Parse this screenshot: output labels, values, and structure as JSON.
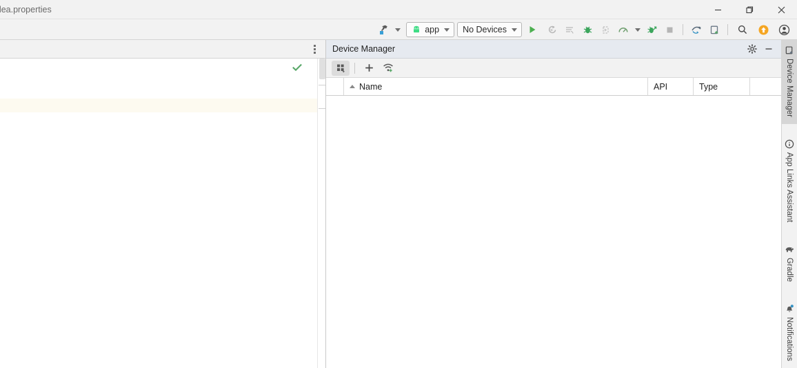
{
  "window": {
    "title": "idea.properties",
    "controls": {
      "minimize": "Minimize",
      "restore": "Restore",
      "close": "Close"
    }
  },
  "toolbar": {
    "build_icon": "hammer-build-icon",
    "build_dropdown": "chevron-down-icon",
    "run_config": {
      "icon": "android-robot-icon",
      "label": "app",
      "dropdown": "chevron-down-icon"
    },
    "device_selector": {
      "label": "No Devices",
      "dropdown": "chevron-down-icon"
    },
    "actions": [
      {
        "name": "run-button",
        "icon": "play-triangle-icon",
        "label": "Run",
        "color": "#4caf50"
      },
      {
        "name": "apply-changes-button",
        "icon": "apply-changes-icon",
        "label": "Apply Changes",
        "color": "#b0b0b0"
      },
      {
        "name": "run-with-coverage-button",
        "icon": "coverage-lines-icon",
        "label": "Run with Coverage",
        "color": "#b0b0b0"
      },
      {
        "name": "debug-button",
        "icon": "bug-icon",
        "label": "Debug",
        "color": "#3ba55c"
      },
      {
        "name": "attach-debugger-button",
        "icon": "attach-debugger-icon",
        "label": "Attach Debugger to Process",
        "color": "#b0b0b0"
      },
      {
        "name": "profiler-button",
        "icon": "profiler-gauge-icon",
        "label": "Profile",
        "color": "#6e9e6e"
      },
      {
        "name": "profiler-dropdown",
        "icon": "chevron-down-icon",
        "label": "Profiler Options",
        "color": "#6e6e6e"
      },
      {
        "name": "debug-attach-button",
        "icon": "bug-arrow-icon",
        "label": "Debug Attach",
        "color": "#3ba55c"
      },
      {
        "name": "stop-button",
        "icon": "stop-square-icon",
        "label": "Stop",
        "color": "#b0b0b0"
      },
      {
        "name": "sync-gradle-button",
        "icon": "gradle-sync-icon",
        "label": "Sync Project with Gradle Files",
        "color": "#5a6b7a"
      },
      {
        "name": "avd-manager-button",
        "icon": "device-manager-icon",
        "label": "Device Manager",
        "color": "#5a6b7a"
      },
      {
        "name": "search-everywhere-button",
        "icon": "search-icon",
        "label": "Search Everywhere",
        "color": "#4a4a4a"
      },
      {
        "name": "update-available-button",
        "icon": "update-arrow-up-icon",
        "label": "Update Available",
        "color": "#f5a623"
      },
      {
        "name": "account-button",
        "icon": "user-account-icon",
        "label": "Account",
        "color": "#4a4a4a"
      }
    ]
  },
  "editor": {
    "tab_options_icon": "more-options-kebab-icon",
    "inspection_status_icon": "green-check-icon",
    "inspection_status_color": "#59a869",
    "content": "",
    "caret_line_color": "#fdfaf0"
  },
  "device_manager": {
    "title": "Device Manager",
    "header_icons": [
      {
        "name": "settings-gear-icon",
        "label": "Settings"
      },
      {
        "name": "hide-panel-icon",
        "label": "Hide"
      }
    ],
    "toolbar": [
      {
        "name": "device-category-button",
        "icon": "grid-categories-icon",
        "label": "Device Categories",
        "active": true
      },
      {
        "name": "create-device-button",
        "icon": "plus-icon",
        "label": "Create Device"
      },
      {
        "name": "pair-wifi-button",
        "icon": "wifi-pair-icon",
        "label": "Pair Devices Using Wi-Fi"
      }
    ],
    "table": {
      "columns": [
        {
          "key": "gutter",
          "label": ""
        },
        {
          "key": "name",
          "label": "Name",
          "sort": "asc"
        },
        {
          "key": "api",
          "label": "API"
        },
        {
          "key": "type",
          "label": "Type"
        },
        {
          "key": "actions",
          "label": ""
        }
      ],
      "rows": []
    }
  },
  "rail": {
    "items": [
      {
        "name": "device-manager",
        "label": "Device Manager",
        "icon": "device-manager-icon",
        "selected": true
      },
      {
        "name": "app-links-assistant",
        "label": "App Links Assistant",
        "icon": "link-circle-icon",
        "selected": false
      },
      {
        "name": "gradle",
        "label": "Gradle",
        "icon": "gradle-elephant-icon",
        "selected": false
      },
      {
        "name": "notifications",
        "label": "Notifications",
        "icon": "bell-icon",
        "selected": false,
        "badge": true
      }
    ]
  },
  "colors": {
    "titlebar_bg": "#f2f2f2",
    "toolbar_bg": "#f2f2f2",
    "panel_header_bg": "#e6eaf0",
    "editor_bg": "#ffffff",
    "accent_orange": "#f5a623",
    "accent_green": "#4caf50",
    "badge_blue": "#3592c4"
  }
}
